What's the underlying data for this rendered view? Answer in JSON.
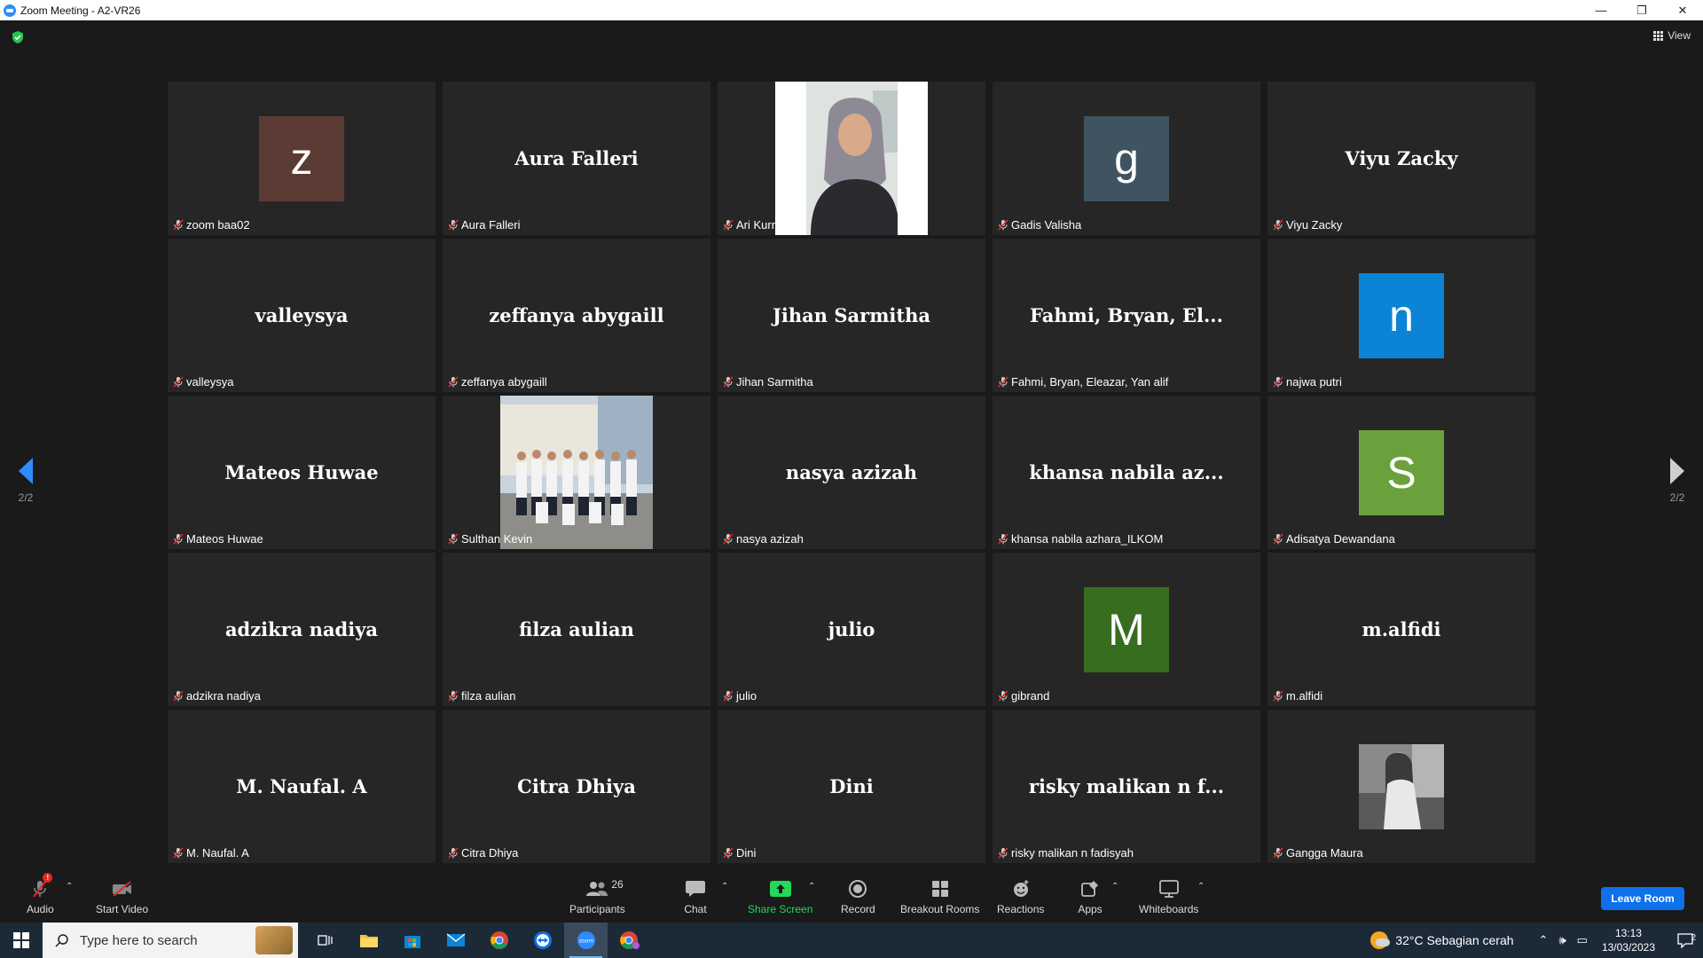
{
  "window": {
    "title": "Zoom Meeting - A2-VR26",
    "controls": [
      "—",
      "❐",
      "✕"
    ]
  },
  "view_label": "View",
  "pagination": {
    "left": "2/2",
    "right": "2/2"
  },
  "tiles": [
    {
      "label": "zoom baa02",
      "kind": "avatar",
      "letter": "z",
      "color": "#5b3b34"
    },
    {
      "label": "Aura Falleri",
      "kind": "name",
      "display": "Aura Falleri"
    },
    {
      "label": "Ari Kurnia",
      "kind": "photo",
      "photo": "woman-hijab"
    },
    {
      "label": "Gadis Valisha",
      "kind": "avatar",
      "letter": "g",
      "color": "#3f5360"
    },
    {
      "label": "Viyu Zacky",
      "kind": "name",
      "display": "Viyu Zacky"
    },
    {
      "label": "valleysya",
      "kind": "name",
      "display": "valleysya"
    },
    {
      "label": "zeffanya abygaill",
      "kind": "name",
      "display": "zeffanya abygaill"
    },
    {
      "label": "Jihan Sarmitha",
      "kind": "name",
      "display": "Jihan Sarmitha"
    },
    {
      "label": "Fahmi, Bryan, Eleazar, Yan alif",
      "kind": "name",
      "display": "Fahmi,  Bryan,  El..."
    },
    {
      "label": "najwa putri",
      "kind": "avatar",
      "letter": "n",
      "color": "#0b84d6"
    },
    {
      "label": "Mateos Huwae",
      "kind": "name",
      "display": "Mateos Huwae"
    },
    {
      "label": "Sulthan Kevin",
      "kind": "photo",
      "photo": "group"
    },
    {
      "label": "nasya azizah",
      "kind": "name",
      "display": "nasya azizah"
    },
    {
      "label": "khansa nabila azhara_ILKOM",
      "kind": "name",
      "display": "khansa  nabila  az..."
    },
    {
      "label": "Adisatya Dewandana",
      "kind": "avatar",
      "letter": "S",
      "color": "#6aa13c"
    },
    {
      "label": "adzikra nadiya",
      "kind": "name",
      "display": "adzikra nadiya"
    },
    {
      "label": "filza aulian",
      "kind": "name",
      "display": "filza aulian"
    },
    {
      "label": "julio",
      "kind": "name",
      "display": "julio"
    },
    {
      "label": "gibrand",
      "kind": "avatar",
      "letter": "M",
      "color": "#376d1f"
    },
    {
      "label": "m.alfidi",
      "kind": "name",
      "display": "m.alfidi"
    },
    {
      "label": "M. Naufal. A",
      "kind": "name",
      "display": "M. Naufal. A"
    },
    {
      "label": "Citra Dhiya",
      "kind": "name",
      "display": "Citra Dhiya"
    },
    {
      "label": "Dini",
      "kind": "name",
      "display": "Dini"
    },
    {
      "label": "risky malikan n fadisyah",
      "kind": "name",
      "display": "risky  malikan  n  f..."
    },
    {
      "label": "Gangga Maura",
      "kind": "photo",
      "photo": "bw-small"
    }
  ],
  "toolbar": {
    "audio": "Audio",
    "audio_badge": "!",
    "start_video": "Start Video",
    "participants": "Participants",
    "participant_count": "26",
    "chat": "Chat",
    "share_screen": "Share Screen",
    "record": "Record",
    "breakout_rooms": "Breakout Rooms",
    "reactions": "Reactions",
    "apps": "Apps",
    "whiteboards": "Whiteboards",
    "leave": "Leave Room"
  },
  "taskbar": {
    "search_placeholder": "Type here to search",
    "weather": "32°C  Sebagian cerah",
    "time": "13:13",
    "date": "13/03/2023",
    "notifications": "2"
  }
}
